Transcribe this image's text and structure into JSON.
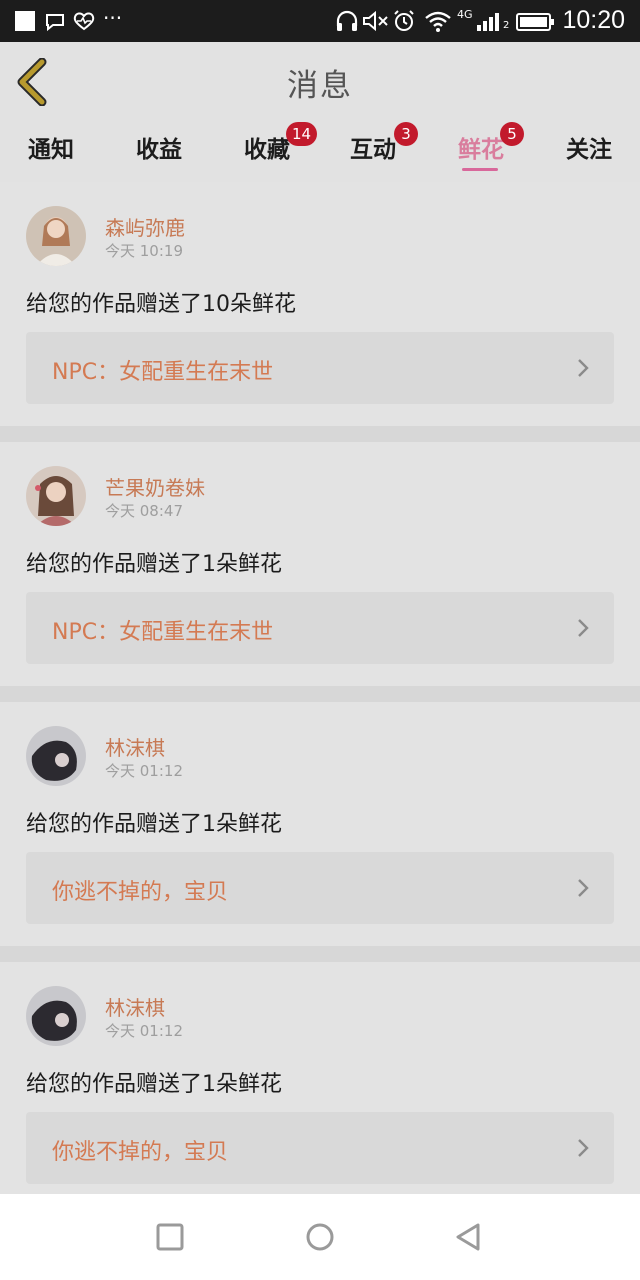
{
  "status_bar": {
    "time": "10:20",
    "network": "4G",
    "sim": "2"
  },
  "header": {
    "title": "消息"
  },
  "tabs": [
    {
      "label": "通知"
    },
    {
      "label": "收益"
    },
    {
      "label": "收藏",
      "badge": "14"
    },
    {
      "label": "互动",
      "badge": "3"
    },
    {
      "label": "鲜花",
      "badge": "5",
      "active": true
    },
    {
      "label": "关注"
    }
  ],
  "messages": [
    {
      "user": "森屿弥鹿",
      "time": "今天 10:19",
      "text": "给您的作品赠送了10朵鲜花",
      "work": "NPC：女配重生在末世"
    },
    {
      "user": "芒果奶卷妹",
      "time": "今天 08:47",
      "text": "给您的作品赠送了1朵鲜花",
      "work": "NPC：女配重生在末世"
    },
    {
      "user": "林沫棋",
      "time": "今天 01:12",
      "text": "给您的作品赠送了1朵鲜花",
      "work": "你逃不掉的，宝贝"
    },
    {
      "user": "林沫棋",
      "time": "今天 01:12",
      "text": "给您的作品赠送了1朵鲜花",
      "work": "你逃不掉的，宝贝"
    }
  ],
  "colors": {
    "accent": "#d8689b",
    "badge": "#c21a2c",
    "username": "#c77a55",
    "work_title": "#d47a52",
    "back_arrow": "#b89a2e"
  }
}
